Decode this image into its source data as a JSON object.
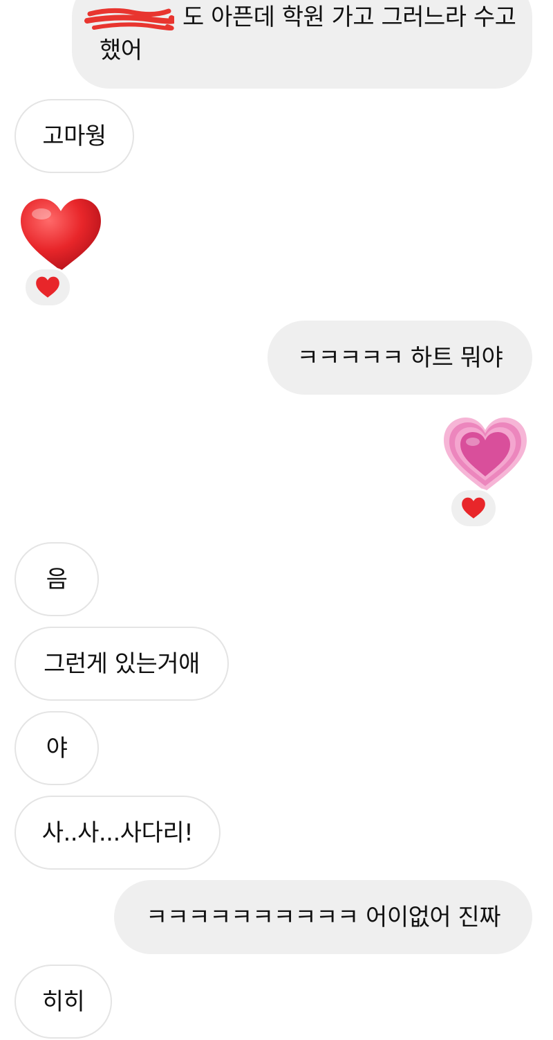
{
  "messages": [
    {
      "id": "m1",
      "side": "sent",
      "text_line1": "도 아픈데 학원 가고 그러느라 수고",
      "text_line2": "했어",
      "redacted": true
    },
    {
      "id": "m2",
      "side": "received",
      "text": "고마웡"
    },
    {
      "id": "m3",
      "side": "received",
      "emoji": "red-heart",
      "reaction": "red-heart"
    },
    {
      "id": "m4",
      "side": "sent",
      "text": "ㅋㅋㅋㅋㅋ 하트 뭐야"
    },
    {
      "id": "m5",
      "side": "sent",
      "emoji": "growing-heart",
      "reaction": "red-heart"
    },
    {
      "id": "m6",
      "side": "received",
      "text": "음"
    },
    {
      "id": "m7",
      "side": "received",
      "text": "그런게 있는거애"
    },
    {
      "id": "m8",
      "side": "received",
      "text": "야"
    },
    {
      "id": "m9",
      "side": "received",
      "text": "사..사...사다리!"
    },
    {
      "id": "m10",
      "side": "sent",
      "text": "ㅋㅋㅋㅋㅋㅋㅋㅋㅋㅋ 어이없어 진짜"
    },
    {
      "id": "m11",
      "side": "received",
      "text": "히히"
    }
  ],
  "colors": {
    "sent_bubble": "#efefef",
    "received_border": "#e4e4e4",
    "heart_red": "#e8262a",
    "heart_pink": "#d94f9b",
    "redaction": "#e8352f"
  }
}
